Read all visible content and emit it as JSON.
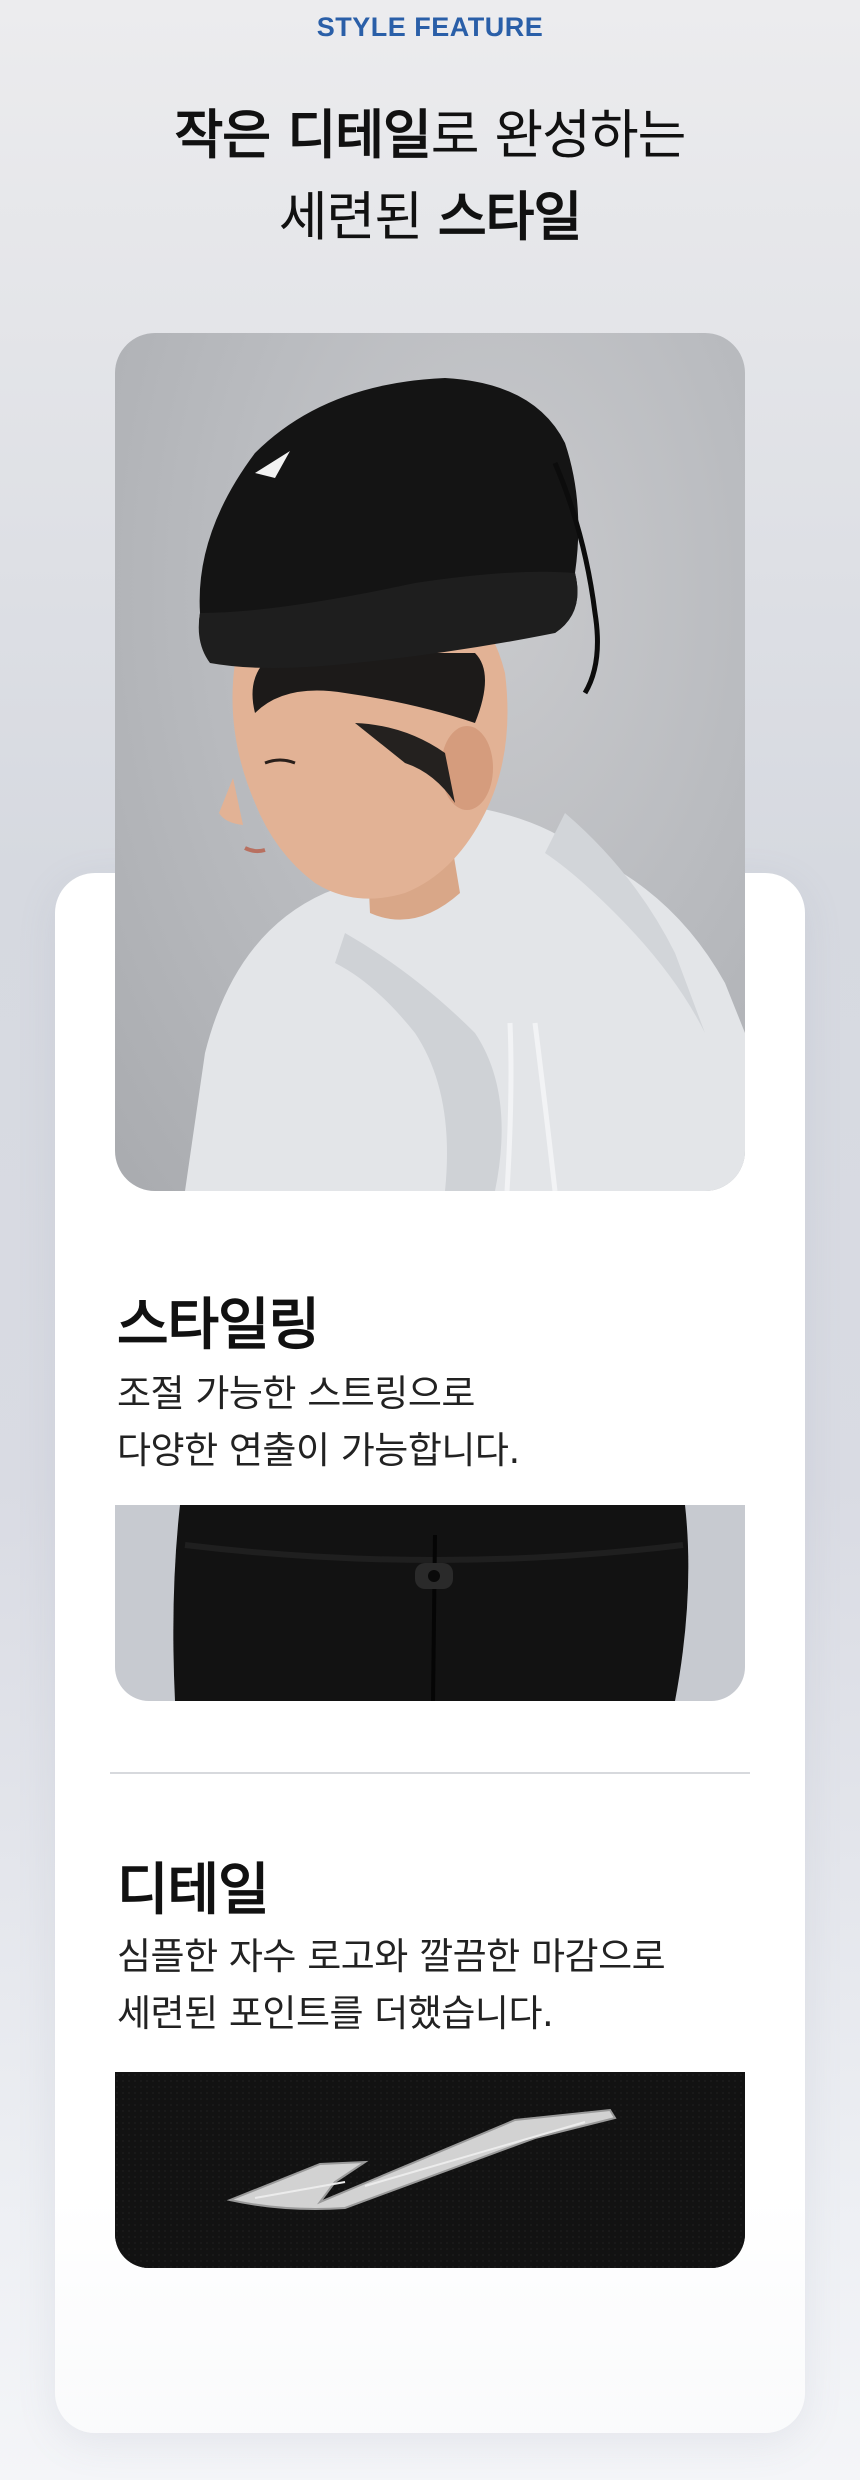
{
  "header": {
    "eyebrow": "STYLE FEATURE",
    "headline_line1_bold1": "작은 디테일",
    "headline_line1_normal": "로 완성하는",
    "headline_line2_normal": "세련된 ",
    "headline_line2_bold": "스타일"
  },
  "sections": [
    {
      "title": "스타일링",
      "desc_line1": "조절 가능한 스트링으로",
      "desc_line2": "다양한 연출이 가능합니다."
    },
    {
      "title": "디테일",
      "desc_line1": "심플한 자수 로고와 깔끔한 마감으로",
      "desc_line2": "세련된 포인트를 더했습니다."
    }
  ],
  "colors": {
    "accent": "#2a5fa8",
    "fleece": "#141414",
    "embroidery": "#d8d8d8"
  }
}
